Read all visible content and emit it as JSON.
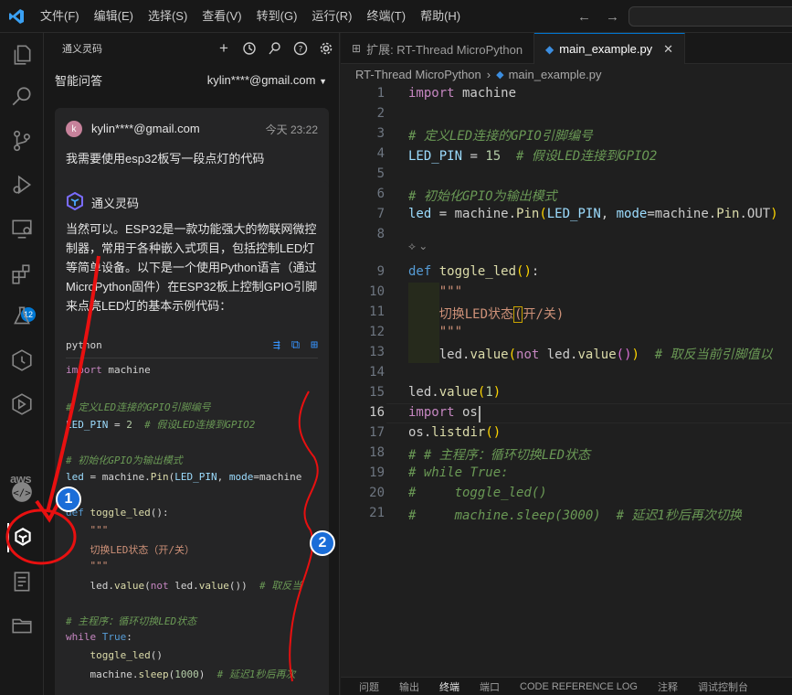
{
  "titlebar": {
    "menu": [
      "文件(F)",
      "编辑(E)",
      "选择(S)",
      "查看(V)",
      "转到(G)",
      "运行(R)",
      "终端(T)",
      "帮助(H)"
    ]
  },
  "activity": {
    "extensions_badge": "12",
    "aws_label": "aws"
  },
  "sidebar": {
    "title": "通义灵码",
    "subheader": "智能问答",
    "account": "kylin****@gmail.com",
    "user_message": {
      "avatar_letter": "k",
      "name": "kylin****@gmail.com",
      "time": "今天 23:22",
      "text": "我需要使用esp32板写一段点灯的代码"
    },
    "ai_message": {
      "name": "通义灵码",
      "lines": [
        "当然可以。ESP32是一款功能强大的物联网微控",
        "制器，常用于各种嵌入式项目，包括控制LED灯",
        "等简单设备。以下是一个使用Python语言（通过",
        "MicroPython固件）在ESP32板上控制GPIO引脚",
        "来点亮LED灯的基本示例代码："
      ],
      "code_lang": "python",
      "snippet": [
        "import machine",
        "",
        "# 定义LED连接的GPIO引脚编号",
        "LED_PIN = 2  # 假设LED连接到GPIO2",
        "",
        "# 初始化GPIO为输出模式",
        "led = machine.Pin(LED_PIN, mode=machine",
        "",
        "def toggle_led():",
        "    \"\"\"",
        "    切换LED状态（开/关）",
        "    \"\"\"",
        "    led.value(not led.value())  # 取反当",
        "",
        "# 主程序：循环切换LED状态",
        "while True:",
        "    toggle_led()",
        "    machine.sleep(1000)  # 延迟1秒后再次"
      ]
    }
  },
  "tabs": [
    {
      "label": "扩展: RT-Thread MicroPython",
      "active": false
    },
    {
      "label": "main_example.py",
      "active": true
    }
  ],
  "breadcrumb": [
    "RT-Thread MicroPython",
    "main_example.py"
  ],
  "editor": {
    "current_line": 16,
    "lines": [
      "import machine",
      "",
      "# 定义LED连接的GPIO引脚编号",
      "LED_PIN = 15  # 假设LED连接到GPIO2",
      "",
      "# 初始化GPIO为输出模式",
      "led = machine.Pin(LED_PIN, mode=machine.Pin.OUT)",
      "",
      "def toggle_led():",
      "    \"\"\"",
      "    切换LED状态 (开/关)",
      "    \"\"\"",
      "    led.value(not led.value())  # 取反当前引脚值以",
      "",
      "led.value(1)",
      "import os",
      "os.listdir()",
      "# # 主程序：循环切换LED状态",
      "# while True:",
      "#     toggle_led()",
      "#     machine.sleep(3000)  # 延迟1秒后再次切换"
    ]
  },
  "panel_tabs": [
    "问题",
    "输出",
    "终端",
    "端口",
    "CODE REFERENCE LOG",
    "注释",
    "调试控制台"
  ],
  "annotations": {
    "badge1": "1",
    "badge2": "2"
  },
  "colors": {
    "accent": "#0078d4",
    "annotation_red": "#e81010",
    "badge_blue": "#1a6dd8"
  }
}
